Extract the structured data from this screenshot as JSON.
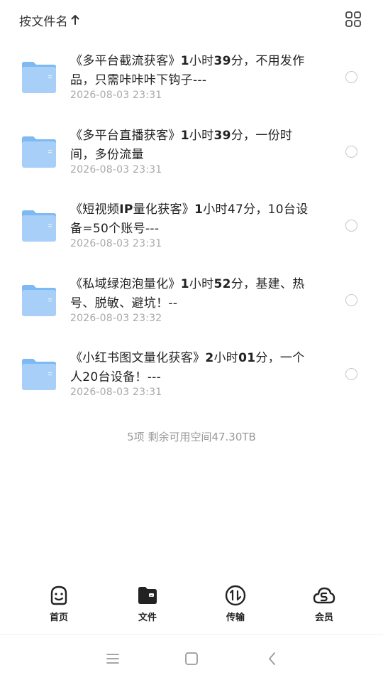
{
  "header": {
    "sort_label": "按文件名",
    "sort_arrow_icon": "arrow-up-icon",
    "view_toggle_icon": "grid-view-icon"
  },
  "files": [
    {
      "name_prefix": "《多平台截流获客》",
      "name_bold": "1",
      "name_rest": "小时",
      "name_bold2": "39",
      "name_tail": "分，不用发作品，只需咔咔咔下钩子---",
      "date": "2026-08-03 23:31"
    },
    {
      "name_prefix": "《多平台直播获客》",
      "name_bold": "1",
      "name_rest": "小时",
      "name_bold2": "39",
      "name_tail": "分，一份时间，多份流量",
      "date": "2026-08-03 23:31"
    },
    {
      "name_prefix": "《短视频",
      "name_bold": "IP",
      "name_rest": "量化获客》",
      "name_bold2": "1",
      "name_tail": "小时47分，10台设备=50个账号---",
      "date": "2026-08-03 23:31"
    },
    {
      "name_prefix": "《私域绿泡泡量化》",
      "name_bold": "1",
      "name_rest": "小时",
      "name_bold2": "52",
      "name_tail": "分，基建、热号、脱敏、避坑！--",
      "date": "2026-08-03 23:32"
    },
    {
      "name_prefix": "《小红书图文量化获客》",
      "name_bold": "2",
      "name_rest": "小时",
      "name_bold2": "01",
      "name_tail": "分，一个人20台设备！---",
      "date": "2026-08-03 23:31"
    }
  ],
  "summary": "5项 剩余可用空间47.30TB",
  "tabs": [
    {
      "label": "首页",
      "icon": "home-face-icon"
    },
    {
      "label": "文件",
      "icon": "folder-file-icon"
    },
    {
      "label": "传输",
      "icon": "transfer-icon"
    },
    {
      "label": "会员",
      "icon": "vip-cloud-icon"
    }
  ],
  "navbar": {
    "menu_icon": "menu-icon",
    "home_icon": "square-home-icon",
    "back_icon": "back-chevron-icon"
  },
  "colors": {
    "folder_light": "#a7cff7",
    "folder_dark": "#7db9f2",
    "text_primary": "#222222",
    "text_secondary": "#a8a8a8"
  }
}
